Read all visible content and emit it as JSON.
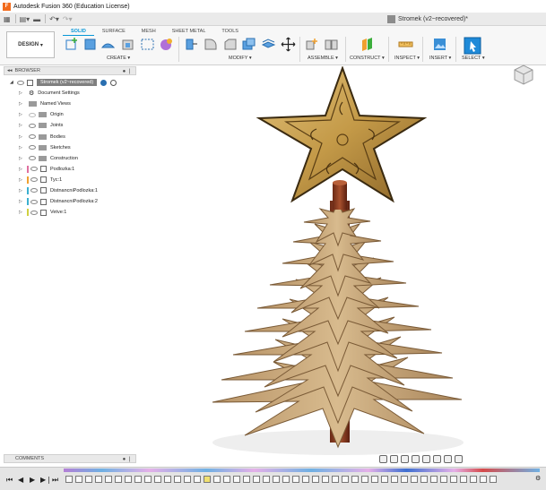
{
  "window": {
    "title": "Autodesk Fusion 360 (Education License)",
    "app_icon_letter": "F"
  },
  "document": {
    "tab_title": "Stromek (v2~recovered)*"
  },
  "workspace": {
    "label": "DESIGN"
  },
  "ribbon": {
    "tabs": [
      {
        "label": "SOLID",
        "active": true
      },
      {
        "label": "SURFACE",
        "active": false
      },
      {
        "label": "MESH",
        "active": false
      },
      {
        "label": "SHEET METAL",
        "active": false
      },
      {
        "label": "TOOLS",
        "active": false
      }
    ],
    "groups": {
      "create": "CREATE",
      "modify": "MODIFY",
      "assemble": "ASSEMBLE",
      "construct": "CONSTRUCT",
      "inspect": "INSPECT",
      "insert": "INSERT",
      "select": "SELECT"
    },
    "accent_color": "#0696d7"
  },
  "browser": {
    "header": "BROWSER",
    "root_label": "Stromek (v2~recovered)",
    "items": [
      {
        "label": "Document Settings",
        "icon": "gear-icon"
      },
      {
        "label": "Named Views",
        "icon": "folder-icon"
      },
      {
        "label": "Origin",
        "icon": "folder-icon"
      },
      {
        "label": "Joints",
        "icon": "folder-icon"
      },
      {
        "label": "Bodies",
        "icon": "folder-icon"
      },
      {
        "label": "Sketches",
        "icon": "folder-icon"
      },
      {
        "label": "Construction",
        "icon": "folder-icon"
      },
      {
        "label": "Podlozka:1",
        "icon": "component-icon"
      },
      {
        "label": "Tyc:1",
        "icon": "component-icon"
      },
      {
        "label": "DistnancniPodlozka:1",
        "icon": "component-icon"
      },
      {
        "label": "DistnancniPodlozka:2",
        "icon": "component-icon"
      },
      {
        "label": "Vetve:1",
        "icon": "component-icon"
      }
    ]
  },
  "comments": {
    "header": "COMMENTS"
  },
  "colors": {
    "star_gold": "#c9a455",
    "wood_light": "#c8a87a",
    "wood_dark": "#8a6a45",
    "rod_red": "#8a3a22"
  }
}
